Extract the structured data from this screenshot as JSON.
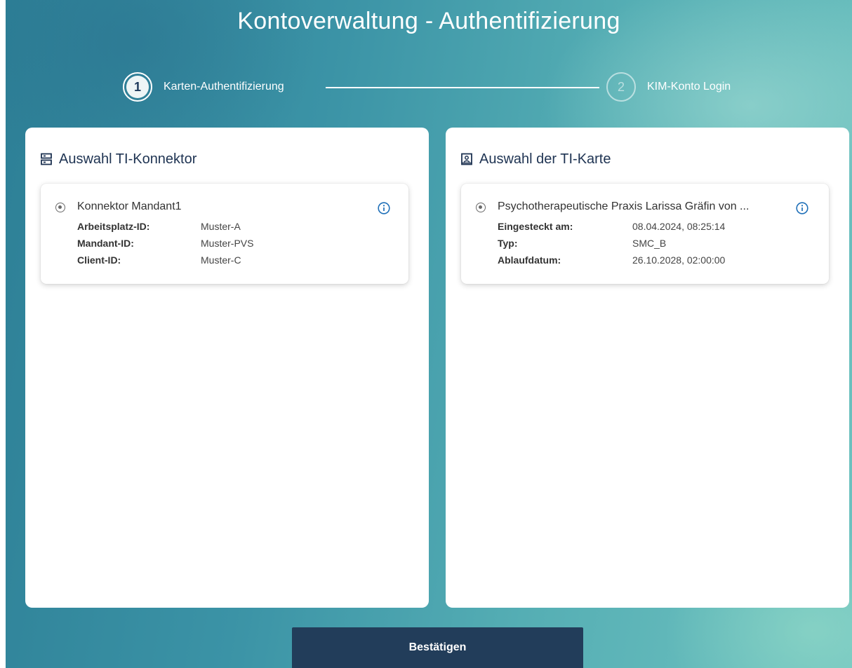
{
  "page": {
    "title": "Kontoverwaltung - Authentifizierung"
  },
  "stepper": {
    "steps": [
      {
        "number": "1",
        "label": "Karten-Authentifizierung",
        "state": "active"
      },
      {
        "number": "2",
        "label": "KIM-Konto Login",
        "state": "inactive"
      }
    ]
  },
  "connector_panel": {
    "title": "Auswahl TI-Konnektor",
    "icon": "server-icon",
    "entry": {
      "name": "Konnektor Mandant1",
      "selected": true,
      "fields": [
        {
          "label": "Arbeitsplatz-ID:",
          "value": "Muster-A"
        },
        {
          "label": "Mandant-ID:",
          "value": "Muster-PVS"
        },
        {
          "label": "Client-ID:",
          "value": "Muster-C"
        }
      ]
    }
  },
  "card_panel": {
    "title": "Auswahl der TI-Karte",
    "icon": "id-card-icon",
    "entry": {
      "name": "Psychotherapeutische Praxis Larissa Gräfin von ...",
      "selected": true,
      "fields": [
        {
          "label": "Eingesteckt am:",
          "value": "08.04.2024, 08:25:14"
        },
        {
          "label": "Typ:",
          "value": "SMC_B"
        },
        {
          "label": "Ablaufdatum:",
          "value": "26.10.2028, 02:00:00"
        }
      ]
    }
  },
  "actions": {
    "confirm_label": "Bestätigen"
  },
  "colors": {
    "primary_dark": "#223d5a",
    "title_text": "#1e3352",
    "info_icon": "#1e6fb8",
    "background_teal": "#3b93a6"
  }
}
